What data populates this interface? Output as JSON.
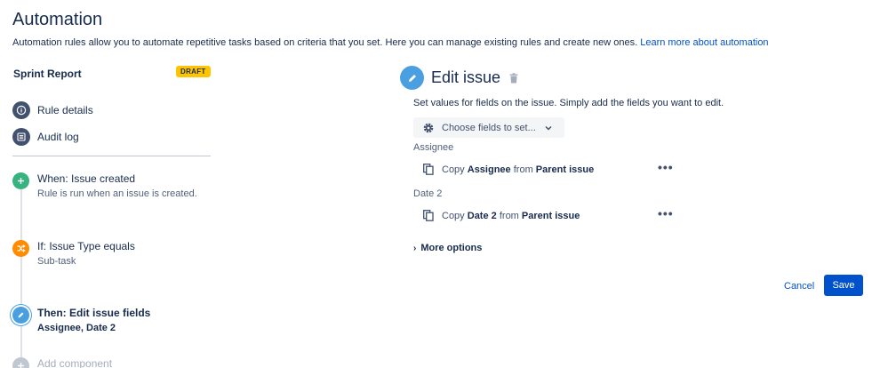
{
  "page": {
    "title": "Automation",
    "description": "Automation rules allow you to automate repetitive tasks based on criteria that you set. Here you can manage existing rules and create new ones.",
    "learn_more": "Learn more about automation"
  },
  "rule": {
    "name": "Sprint Report",
    "status_badge": "DRAFT"
  },
  "nav": {
    "rule_details": "Rule details",
    "audit_log": "Audit log"
  },
  "steps": [
    {
      "title": "When: Issue created",
      "subtitle": "Rule is run when an issue is created.",
      "color": "#36b37e"
    },
    {
      "title": "If: Issue Type equals",
      "subtitle": "Sub-task",
      "color": "#ff8b00"
    },
    {
      "title": "Then: Edit issue fields",
      "subtitle": "Assignee, Date 2",
      "color": "#4a9fe0"
    },
    {
      "title": "Add component",
      "subtitle": "",
      "color": "#c1c7d0"
    }
  ],
  "editor": {
    "title": "Edit issue",
    "description": "Set values for fields on the issue. Simply add the fields you want to edit.",
    "choose_fields": "Choose fields to set...",
    "fields": [
      {
        "label": "Assignee",
        "prefix": "Copy",
        "field": "Assignee",
        "middle": "from",
        "source": "Parent issue"
      },
      {
        "label": "Date 2",
        "prefix": "Copy",
        "field": "Date 2",
        "middle": "from",
        "source": "Parent issue"
      }
    ],
    "more_options": "More options",
    "cancel": "Cancel",
    "save": "Save"
  },
  "colors": {
    "accent": "#0052cc",
    "draft": "#ffc400"
  }
}
